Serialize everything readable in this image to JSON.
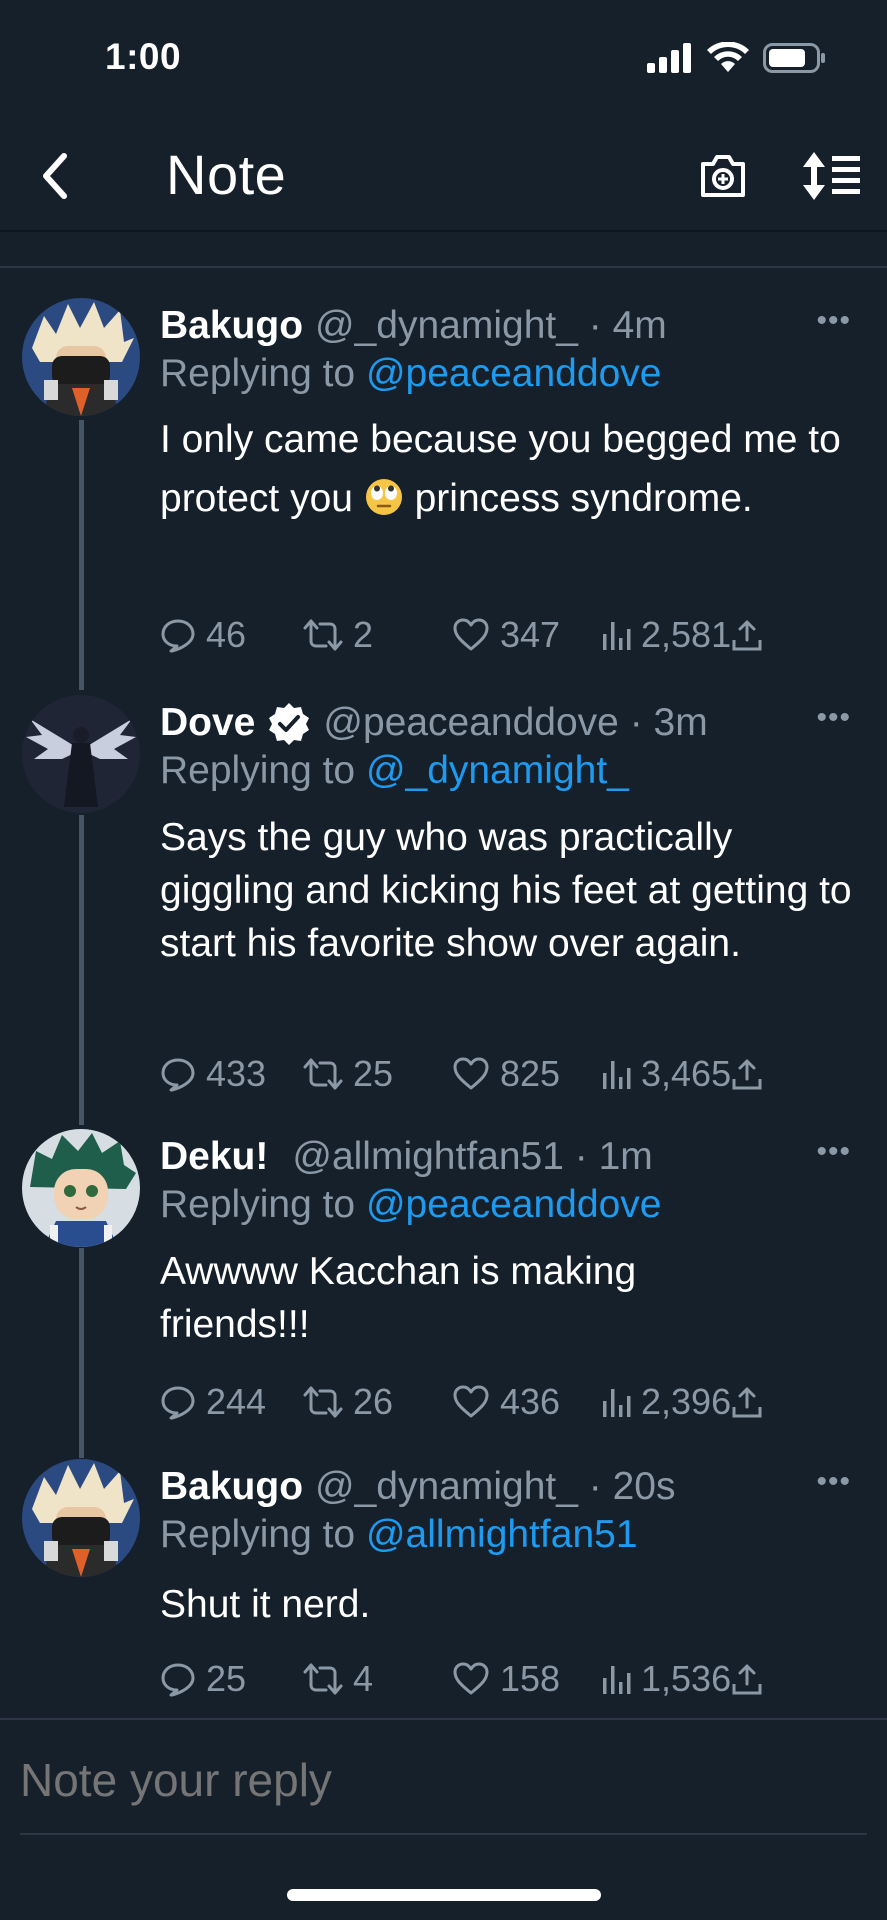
{
  "status": {
    "time": "1:00"
  },
  "nav": {
    "title": "Note"
  },
  "tweets": [
    {
      "name": "Bakugo",
      "handle": "@_dynamight_ · 4m",
      "replying_prefix": "Replying to ",
      "replying_to": "@peaceanddove",
      "text_before": "I only came because you begged me to protect you ",
      "emoji": "🙄",
      "text_after": " princess syndrome.",
      "replies": "46",
      "retweets": "2",
      "likes": "347",
      "views": "2,581",
      "verified": false
    },
    {
      "name": "Dove",
      "handle": "@peaceanddove · 3m",
      "replying_prefix": "Replying to ",
      "replying_to": "@_dynamight_",
      "text": "Says the guy who was practically giggling and kicking his feet at getting to start his favorite show over again.",
      "replies": "433",
      "retweets": "25",
      "likes": "825",
      "views": "3,465",
      "verified": true
    },
    {
      "name": "Deku!",
      "handle": "@allmightfan51 · 1m",
      "replying_prefix": "Replying to ",
      "replying_to": "@peaceanddove",
      "text": "Awwww Kacchan is making friends!!!",
      "replies": "244",
      "retweets": "26",
      "likes": "436",
      "views": "2,396",
      "verified": false
    },
    {
      "name": "Bakugo",
      "handle": "@_dynamight_ · 20s",
      "replying_prefix": "Replying to ",
      "replying_to": "@allmightfan51",
      "text": "Shut it nerd.",
      "replies": "25",
      "retweets": "4",
      "likes": "158",
      "views": "1,536",
      "verified": false
    }
  ],
  "more_label": "•••",
  "reply": {
    "placeholder": "Note your reply"
  },
  "colors": {
    "background": "#15202b",
    "link": "#1d9bf0",
    "muted": "#8b98a5"
  }
}
